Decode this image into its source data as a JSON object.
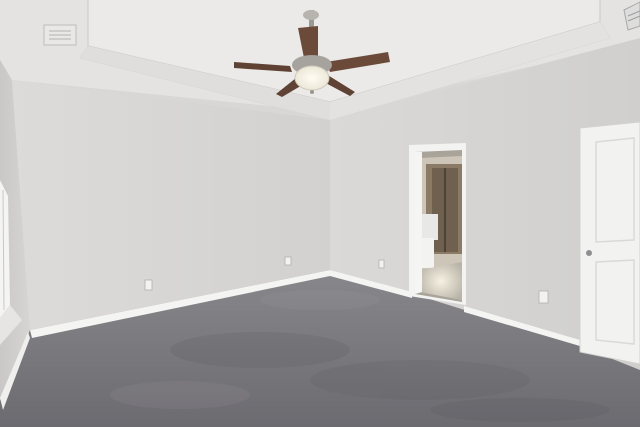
{
  "scene": {
    "subject": "empty-bedroom",
    "colors": {
      "ceiling": "#e6e5e3",
      "wall_left": "#d3d2d0",
      "wall_back": "#dddcda",
      "wall_right": "#d6d5d3",
      "carpet": "#77767a",
      "trim": "#f4f4f2",
      "door": "#f2f2f1",
      "fan_blade": "#6b4a3a"
    },
    "icons": {
      "ceiling_fan": "ceiling-fan-icon",
      "air_vent": "air-vent-icon",
      "outlet": "outlet-icon"
    }
  }
}
